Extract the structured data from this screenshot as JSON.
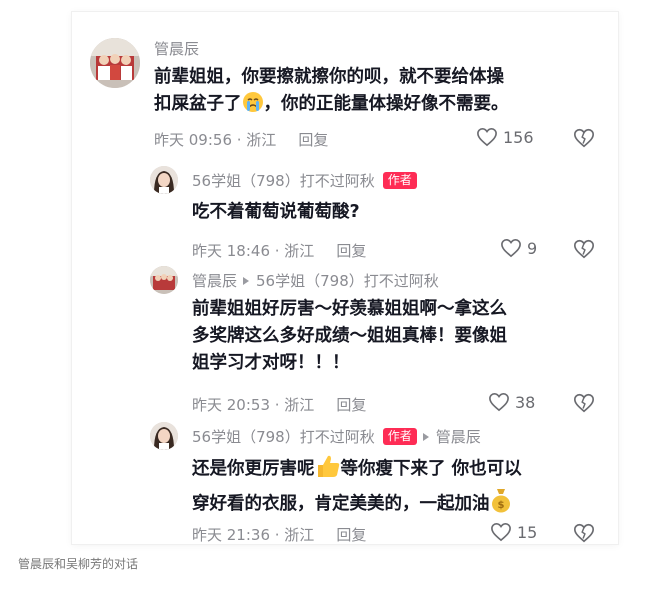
{
  "comments": [
    {
      "username": "管晨辰",
      "text_line1": "前辈姐姐，你要擦就擦你的呗，就不要给体操",
      "text_line2_a": "扣屎盆子了",
      "text_line2_b": "，你的正能量体操好像不需要。",
      "time_location": "昨天 09:56 · 浙江",
      "reply_label": "回复",
      "likes": "156",
      "emoji": "crying-face"
    },
    {
      "username": "56学姐（798）打不过阿秋",
      "author_tag": "作者",
      "text": "吃不着葡萄说葡萄酸?",
      "time_location": "昨天 18:46 · 浙江",
      "reply_label": "回复",
      "likes": "9"
    },
    {
      "username": "管晨辰",
      "reply_to": "56学姐（798）打不过阿秋",
      "text_line1": "前辈姐姐好厉害～好羡慕姐姐啊～拿这么",
      "text_line2": "多奖牌这么多好成绩～姐姐真棒！要像姐",
      "text_line3": "姐学习才对呀！！！",
      "time_location": "昨天 20:53 · 浙江",
      "reply_label": "回复",
      "likes": "38"
    },
    {
      "username": "56学姐（798）打不过阿秋",
      "author_tag": "作者",
      "reply_to": "管晨辰",
      "text_line1_a": "还是你更厉害呢",
      "text_line1_b": "等你瘦下来了 你也可以",
      "text_line2_a": "穿好看的衣服，肯定美美的，一起加油",
      "time_location": "昨天 21:36 · 浙江",
      "reply_label": "回复",
      "likes": "15",
      "emojis": [
        "thumbs-up",
        "money-bag"
      ]
    }
  ],
  "caption": "管晨辰和吴柳芳的对话",
  "colors": {
    "author_tag_bg": "#fe2c55",
    "meta_gray": "#8a8b91",
    "text_dark": "#161823"
  }
}
